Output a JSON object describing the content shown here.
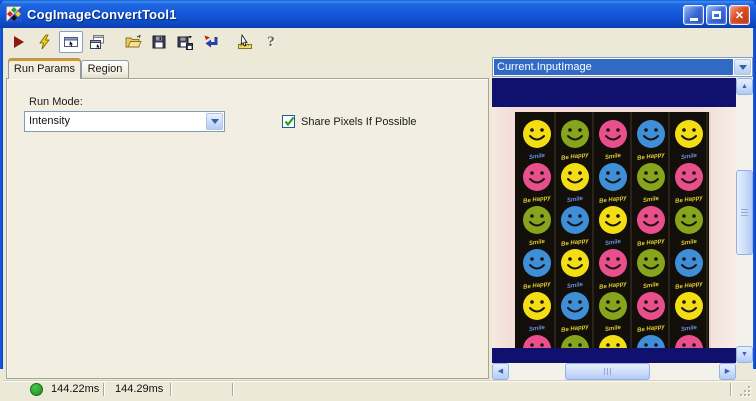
{
  "window": {
    "title": "CogImageConvertTool1"
  },
  "titlebar": {
    "buttons": [
      "minimize",
      "maximize",
      "close"
    ]
  },
  "toolbar": {
    "icons": [
      "run-icon",
      "electric-run-icon",
      "float-result-window-icon",
      "copy-window-icon",
      "open-file-icon",
      "save-icon",
      "save-as-icon",
      "revert-icon",
      "pointer-ruler-icon",
      "help-icon"
    ]
  },
  "tabs": [
    {
      "label": "Run Params",
      "active": true
    },
    {
      "label": "Region",
      "active": false
    }
  ],
  "run_params": {
    "run_mode_label": "Run Mode:",
    "run_mode_value": "Intensity",
    "share_pixels_label": "Share Pixels If Possible",
    "share_pixels_checked": true
  },
  "image_panel": {
    "selector_value": "Current.InputImage",
    "image_description": "sticker sheet photo of colored smiley faces on black background with dark blue bands above and below",
    "smiley_grid": {
      "rows": [
        [
          "yellow",
          "green",
          "pink",
          "blue",
          "yellow"
        ],
        [
          "pink",
          "yellow",
          "blue",
          "green",
          "pink"
        ],
        [
          "green",
          "blue",
          "yellow",
          "pink",
          "green"
        ],
        [
          "blue",
          "yellow",
          "pink",
          "green",
          "blue"
        ],
        [
          "yellow",
          "blue",
          "green",
          "pink",
          "yellow"
        ],
        [
          "pink",
          "green",
          "yellow",
          "blue",
          "pink"
        ]
      ],
      "captions": [
        "Smile",
        "Be Happy"
      ],
      "colors": {
        "yellow": "#f2de12",
        "green": "#86a41c",
        "pink": "#ea4f8d",
        "blue": "#3e8ed8"
      },
      "caption_colors": {
        "yellow": "#6a8fe0",
        "green": "#e0cc30",
        "pink": "#e0cc30",
        "blue": "#e0cc30"
      }
    }
  },
  "statusbar": {
    "time1": "144.22ms",
    "time2": "144.29ms",
    "indicator_color": "#2ba32b"
  }
}
